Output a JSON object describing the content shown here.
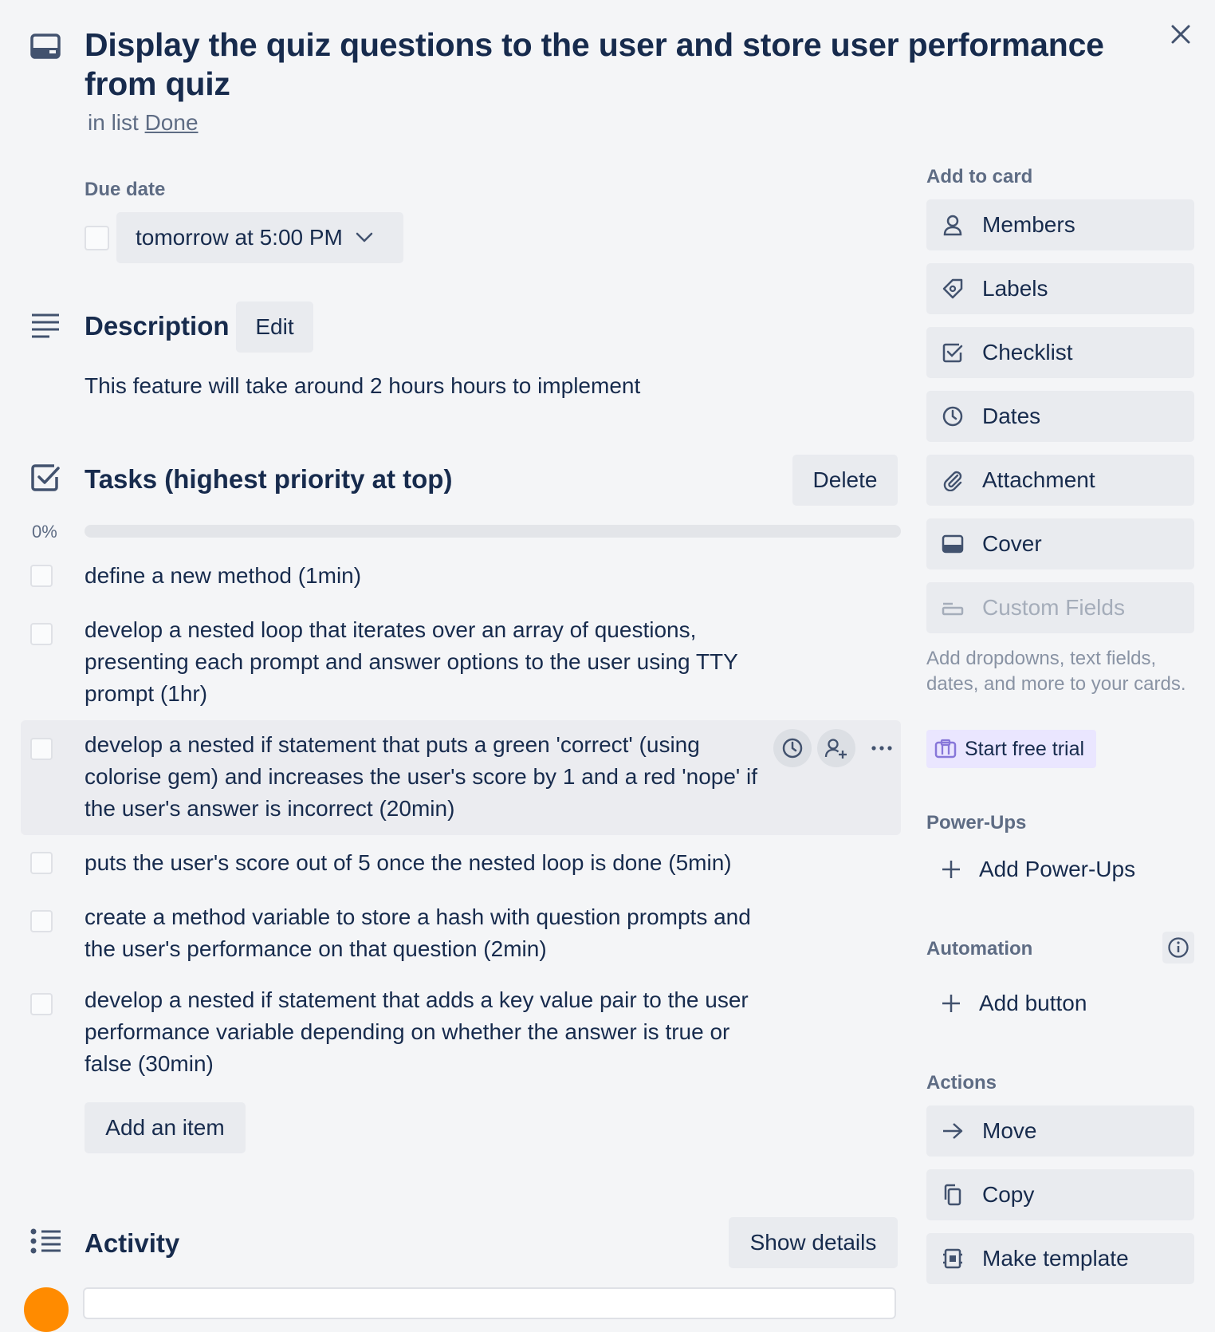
{
  "card": {
    "title": "Display the quiz questions to the user and store user performance from quiz",
    "in_list_prefix": "in list",
    "list_name": "Done",
    "close_icon": "close-icon",
    "card_icon": "card-icon"
  },
  "due_date": {
    "label": "Due date",
    "value": "tomorrow at 5:00 PM",
    "dropdown_icon": "chevron-down-icon"
  },
  "description": {
    "heading": "Description",
    "edit_label": "Edit",
    "text": "This feature will take around 2 hours hours to implement"
  },
  "checklist": {
    "heading": "Tasks (highest priority at top)",
    "delete_label": "Delete",
    "progress_text": "0%",
    "progress": 0,
    "items": [
      {
        "text": "define a new method (1min)"
      },
      {
        "text": "develop a nested loop that iterates over an array of questions, presenting each prompt and answer options to the user using TTY prompt (1hr)"
      },
      {
        "text": "develop a nested if statement that puts a green 'correct' (using colorise gem) and increases the user's score by 1 and a red 'nope' if the user's answer is incorrect (20min)"
      },
      {
        "text": "puts the user's score out of 5 once the nested loop is done (5min)"
      },
      {
        "text": "create a method variable to store a hash with question prompts and the user's performance on that question (2min)"
      },
      {
        "text": "develop a nested if statement that adds a key value pair to the user performance variable depending on whether the answer is true or false (30min)"
      }
    ],
    "add_item_label": "Add an item"
  },
  "activity": {
    "heading": "Activity",
    "show_details_label": "Show details"
  },
  "sidebar": {
    "add_to_card_label": "Add to card",
    "add_to_card": [
      {
        "label": "Members",
        "icon": "person-icon"
      },
      {
        "label": "Labels",
        "icon": "tag-icon"
      },
      {
        "label": "Checklist",
        "icon": "checklist-icon"
      },
      {
        "label": "Dates",
        "icon": "clock-icon"
      },
      {
        "label": "Attachment",
        "icon": "paperclip-icon"
      },
      {
        "label": "Cover",
        "icon": "cover-icon"
      },
      {
        "label": "Custom Fields",
        "icon": "custom-fields-icon",
        "disabled": true
      }
    ],
    "custom_fields_note": "Add dropdowns, text fields, dates, and more to your cards.",
    "trial_label": "Start free trial",
    "power_ups_label": "Power-Ups",
    "add_power_ups_label": "Add Power-Ups",
    "automation_label": "Automation",
    "add_button_label": "Add button",
    "actions_label": "Actions",
    "actions": [
      {
        "label": "Move",
        "icon": "arrow-right-icon"
      },
      {
        "label": "Copy",
        "icon": "copy-icon"
      },
      {
        "label": "Make template",
        "icon": "template-icon"
      }
    ]
  },
  "colors": {
    "background": "#f4f5f7",
    "button": "#e9ebef",
    "text": "#172b4d",
    "muted": "#5e6c84",
    "trial_bg": "#eae6ff",
    "avatar": "#ff8b00"
  }
}
